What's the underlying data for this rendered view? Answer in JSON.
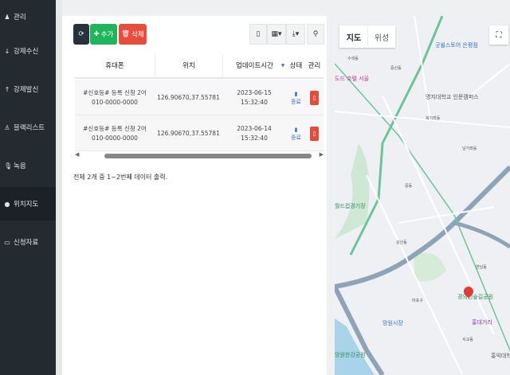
{
  "sidebar": {
    "items": [
      {
        "label": "관리",
        "icon": "users-icon"
      },
      {
        "label": "강제수신",
        "icon": "arrow-down-icon"
      },
      {
        "label": "강제발신",
        "icon": "arrow-up-icon"
      },
      {
        "label": "블랙리스트",
        "icon": "user-block-icon"
      },
      {
        "label": "녹음",
        "icon": "microphone-icon"
      },
      {
        "label": "위치지도",
        "icon": "map-pin-icon",
        "active": true
      },
      {
        "label": "신청자료",
        "icon": "inbox-icon"
      }
    ]
  },
  "toolbar": {
    "refresh": "⟳",
    "add": "추가",
    "delete": "삭제"
  },
  "table": {
    "columns": [
      "휴대폰",
      "위치",
      "업데이트시간",
      "상태",
      "관리"
    ],
    "rows": [
      {
        "phone": "#신호등# 등록 신청 2어",
        "phone2": "010-0000-0000",
        "location": "126.90670,37.55781",
        "time": "2023-06-15",
        "time2": "15:32:40",
        "status": "종료"
      },
      {
        "phone": "#신호등# 등록 신청 2어",
        "phone2": "010-0000-0000",
        "location": "126.90670,37.55781",
        "time": "2023-06-14",
        "time2": "15:32:40",
        "status": "종료"
      }
    ]
  },
  "footer": "전체 2개 중 1~2번째 데이터 출력.",
  "map": {
    "tabs": [
      "지도",
      "위성"
    ],
    "labels": [
      "굿윌스토어 은평점",
      "도드 호텔 서울",
      "명지대학교 인문캠퍼스",
      "수색동",
      "증산동",
      "북가좌동",
      "남가좌동",
      "중동",
      "성산동",
      "마포구",
      "망원시장",
      "연남동",
      "경의선숲길공원",
      "홍대거리",
      "망원한강공원",
      "월드컵경기장",
      "홍익대학",
      "서교동"
    ]
  }
}
